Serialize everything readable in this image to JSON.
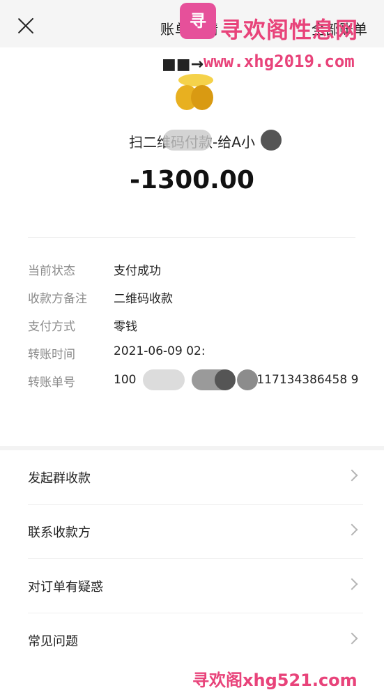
{
  "header": {
    "title": "账单详情",
    "right_link": "全部账单"
  },
  "watermark": {
    "logo": "寻",
    "text": "寻欢阁性息网",
    "arrow": "■■→",
    "url": "www.xhg2019.com",
    "footer": "寻欢阁xhg521.com"
  },
  "summary": {
    "merchant": "扫二维码付款-给A小",
    "amount": "-1300.00"
  },
  "details": [
    {
      "label": "当前状态",
      "value": "支付成功"
    },
    {
      "label": "收款方备注",
      "value": "二维码收款"
    },
    {
      "label": "支付方式",
      "value": "零钱"
    },
    {
      "label": "转账时间",
      "value": "2021-06-09 02:"
    },
    {
      "label": "转账单号",
      "value": "100                              0117134386458 9"
    }
  ],
  "menu": [
    {
      "label": "发起群收款"
    },
    {
      "label": "联系收款方"
    },
    {
      "label": "对订单有疑惑"
    },
    {
      "label": "常见问题"
    }
  ],
  "colors": {
    "accent": "#e8437a",
    "amount": "#111111",
    "label": "#8a8a8a"
  },
  "icons": {
    "close": "close-icon",
    "chevron": "chevron-right-icon"
  }
}
